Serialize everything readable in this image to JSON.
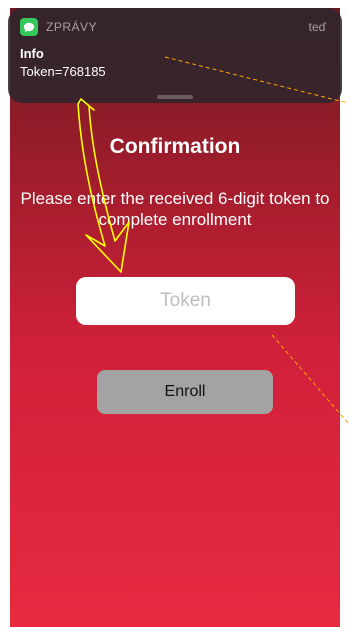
{
  "notification": {
    "app_name": "ZPRÁVY",
    "time": "teď",
    "title": "Info",
    "body": "Token=768185",
    "app_icon": "message-bubble-icon"
  },
  "screen": {
    "title": "Confirmation",
    "instructions": "Please enter the received 6-digit token to complete enrollment",
    "token_input": {
      "value": "",
      "placeholder": "Token"
    },
    "enroll_label": "Enroll"
  },
  "colors": {
    "background_top": "#6e1a22",
    "background_bottom": "#e72a40",
    "app_icon": "#34c759",
    "button": "#a3a3a3",
    "annotation_arrow": "#ffff00",
    "annotation_line": "#ffa500"
  }
}
